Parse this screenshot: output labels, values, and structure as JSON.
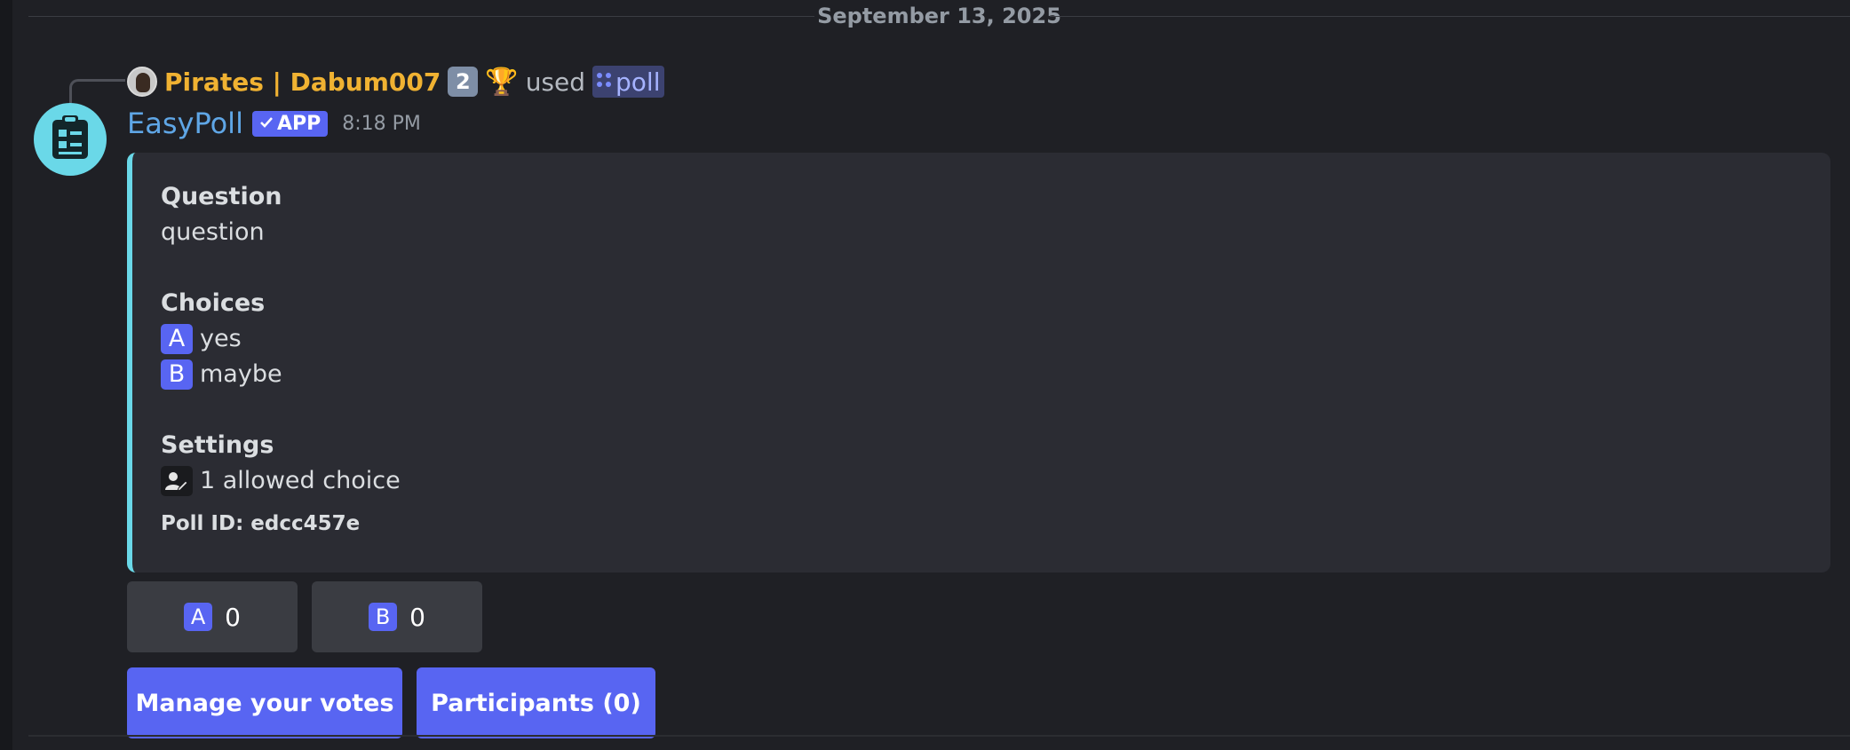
{
  "date_divider": "September 13, 2025",
  "reply": {
    "username": "Pirates | Dabum007",
    "badge_number": "2",
    "trophy": "🏆",
    "used_text": "used",
    "command": "poll"
  },
  "message": {
    "author": "EasyPoll",
    "app_badge": "APP",
    "timestamp": "8:18 PM"
  },
  "embed": {
    "accent_color": "#6ad8e8",
    "question_label": "Question",
    "question_value": "question",
    "choices_label": "Choices",
    "choices": [
      {
        "letter": "A",
        "text": "yes"
      },
      {
        "letter": "B",
        "text": "maybe"
      }
    ],
    "settings_label": "Settings",
    "settings_value": "1 allowed choice",
    "poll_id": "Poll ID: edcc457e"
  },
  "votes": [
    {
      "letter": "A",
      "count": "0"
    },
    {
      "letter": "B",
      "count": "0"
    }
  ],
  "actions": {
    "manage": "Manage your votes",
    "participants": "Participants (0)"
  },
  "icons": {
    "app_avatar": "clipboard-icon",
    "settings": "user-edit-icon",
    "command": "app-grid-icon",
    "check": "check-icon"
  },
  "colors": {
    "brand": "#5865f2",
    "reply_username": "#f0b232",
    "author": "#5fa6e6"
  }
}
